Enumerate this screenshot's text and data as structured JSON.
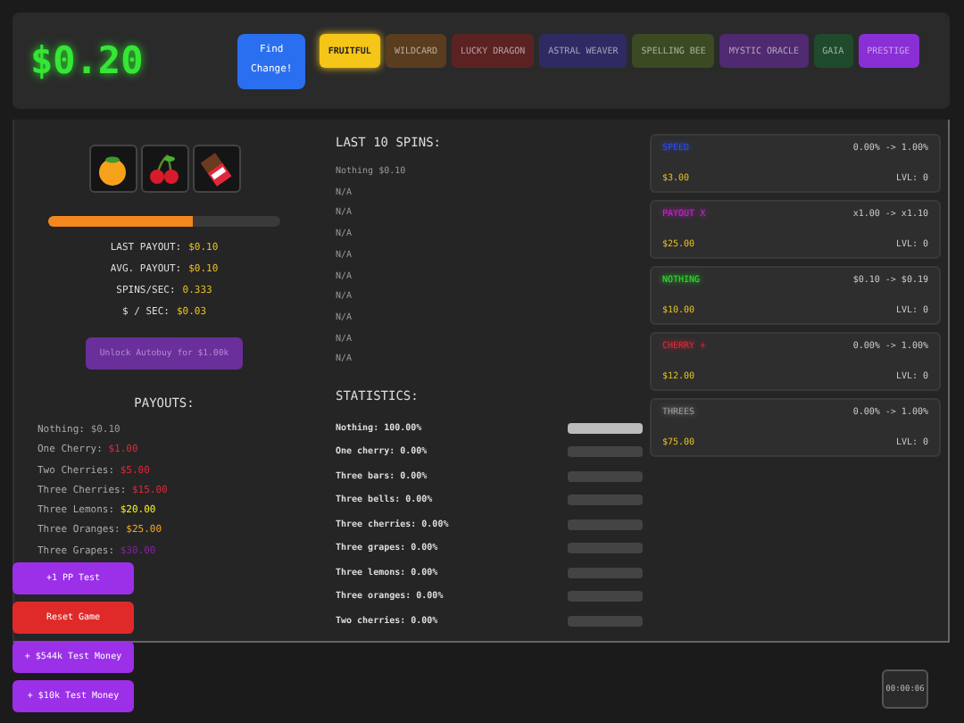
{
  "balance": "$0.20",
  "find_change_button": "Find Change!",
  "tabs": [
    {
      "label": "FRUITFUL",
      "selected": true,
      "color": "#f5c518"
    },
    {
      "label": "WILDCARD",
      "selected": false,
      "color": "#5a3c1e"
    },
    {
      "label": "LUCKY DRAGON",
      "selected": false,
      "color": "#5c2222"
    },
    {
      "label": "ASTRAL WEAVER",
      "selected": false,
      "color": "#2e2b63"
    },
    {
      "label": "SPELLING BEE",
      "selected": false,
      "color": "#3b4a22"
    },
    {
      "label": "MYSTIC ORACLE",
      "selected": false,
      "color": "#4f2a70"
    },
    {
      "label": "GAIA",
      "selected": false,
      "color": "#1f4a2c"
    },
    {
      "label": "PRESTIGE",
      "selected": false,
      "color": "#8a2ed6"
    }
  ],
  "reels": [
    {
      "kind": "orange"
    },
    {
      "kind": "cherry"
    },
    {
      "kind": "chocolate"
    }
  ],
  "spin_progress": {
    "level": 0.62
  },
  "stats": [
    {
      "label": "LAST PAYOUT:",
      "value": "$0.10"
    },
    {
      "label": "AVG. PAYOUT:",
      "value": "$0.10"
    },
    {
      "label": "SPINS/SEC:",
      "value": "0.333"
    },
    {
      "label": "$ / SEC:",
      "value": "$0.03"
    }
  ],
  "autobuy_button": "Unlock Autobuy for $1.00k",
  "payouts": {
    "title": "PAYOUTS:",
    "rows": [
      {
        "label": "Nothing:",
        "value": "$0.10",
        "color": "#9a9a9a"
      },
      {
        "label": "One Cherry:",
        "value": "$1.00",
        "color": "#e0283c"
      },
      {
        "label": "Two Cherries:",
        "value": "$5.00",
        "color": "#e0283c"
      },
      {
        "label": "Three Cherries:",
        "value": "$15.00",
        "color": "#e0283c"
      },
      {
        "label": "Three Lemons:",
        "value": "$20.00",
        "color": "#f2f21e"
      },
      {
        "label": "Three Oranges:",
        "value": "$25.00",
        "color": "#f5a623"
      },
      {
        "label": "Three Grapes:",
        "value": "$30.00",
        "color": "#8a1fa8"
      }
    ]
  },
  "last_spins": {
    "title": "LAST 10 SPINS:",
    "items": [
      "Nothing $0.10",
      "N/A",
      "N/A",
      "N/A",
      "N/A",
      "N/A",
      "N/A",
      "N/A",
      "N/A",
      "N/A"
    ]
  },
  "statistics": {
    "title": "STATISTICS:",
    "rows": [
      {
        "label": "Nothing: 100.00%",
        "level": 1
      },
      {
        "label": "One cherry: 0.00%",
        "level": 0
      },
      {
        "label": "Three bars: 0.00%",
        "level": 0
      },
      {
        "label": "Three bells: 0.00%",
        "level": 0
      },
      {
        "label": "Three cherries: 0.00%",
        "level": 0
      },
      {
        "label": "Three grapes: 0.00%",
        "level": 0
      },
      {
        "label": "Three lemons: 0.00%",
        "level": 0
      },
      {
        "label": "Three oranges: 0.00%",
        "level": 0
      },
      {
        "label": "Two cherries: 0.00%",
        "level": 0
      }
    ]
  },
  "upgrades": [
    {
      "name": "SPEED",
      "color": "#2b4ff0",
      "change": "0.00% -> 1.00%",
      "price": "$3.00",
      "level": "LVL: 0"
    },
    {
      "name": "PAYOUT X",
      "color": "#d81fd8",
      "change": "x1.00 -> x1.10",
      "price": "$25.00",
      "level": "LVL: 0"
    },
    {
      "name": "NOTHING",
      "color": "#2ee62e",
      "change": "$0.10 -> $0.19",
      "price": "$10.00",
      "level": "LVL: 0"
    },
    {
      "name": "CHERRY +",
      "color": "#e0283c",
      "change": "0.00% -> 1.00%",
      "price": "$12.00",
      "level": "LVL: 0"
    },
    {
      "name": "THREES",
      "color": "#9a9a9a",
      "change": "0.00% -> 1.00%",
      "price": "$75.00",
      "level": "LVL: 0"
    }
  ],
  "test_buttons": [
    {
      "label": "+1 PP Test",
      "kind": "test"
    },
    {
      "label": "Reset Game",
      "kind": "danger"
    },
    {
      "label": "+ $544k Test Money",
      "kind": "test"
    },
    {
      "label": "+ $10k Test Money",
      "kind": "test"
    }
  ],
  "timer": "00:00:06"
}
